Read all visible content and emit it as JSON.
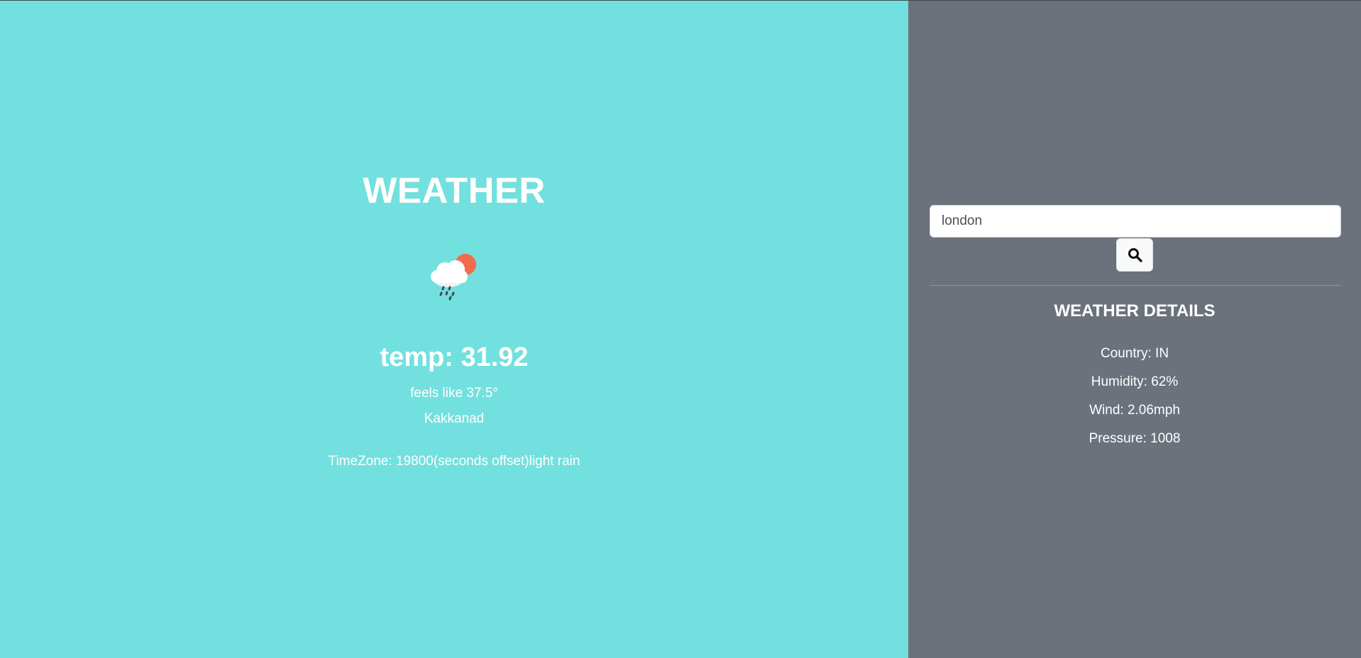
{
  "main": {
    "title": "WEATHER",
    "icon": "cloud-sun-rain-icon",
    "temp_label": "temp: ",
    "temp_value": "31.92",
    "feels_like_label": "feels like ",
    "feels_like_value": "37.5°",
    "city": "Kakkanad",
    "timezone_label": "TimeZone: ",
    "timezone_value": "19800",
    "timezone_unit": "(seconds offset)",
    "description": "light rain"
  },
  "sidebar": {
    "search": {
      "value": "london",
      "placeholder": "",
      "button_icon": "search-icon"
    },
    "details_title": "WEATHER DETAILS",
    "details": [
      {
        "label": "Country: ",
        "value": "IN"
      },
      {
        "label": "Humidity: ",
        "value": "62%"
      },
      {
        "label": "Wind: ",
        "value": "2.06mph"
      },
      {
        "label": "Pressure: ",
        "value": "1008"
      }
    ]
  },
  "colors": {
    "left_background": "#72e0de",
    "right_background": "#6c727c",
    "text": "#ffffff",
    "sun": "#f26b4f",
    "cloud": "#ffffff",
    "rain": "#444a54"
  }
}
